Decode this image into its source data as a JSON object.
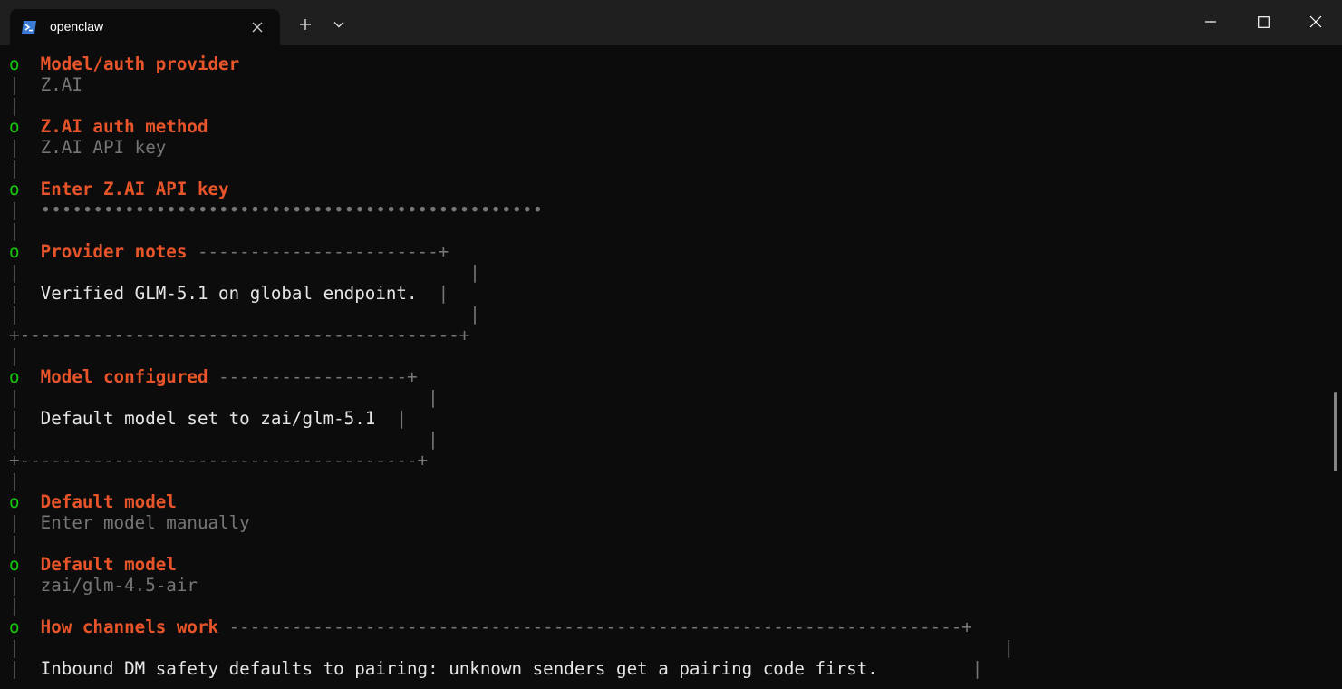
{
  "window": {
    "tab_title": "openclaw",
    "icons": {
      "tab": "powershell-icon",
      "close": "close-icon",
      "new_tab": "plus-icon",
      "dropdown": "chevron-down-icon",
      "minimize": "minimize-icon",
      "maximize": "maximize-icon",
      "window_close": "close-icon"
    }
  },
  "colors": {
    "background": "#0c0c0c",
    "titlebar": "#1f1f1f",
    "heading": "#e8542a",
    "bullet": "#16c60c",
    "dim": "#767676",
    "text": "#e6e6e6"
  },
  "terminal": {
    "glyphs": {
      "bullet": "o",
      "bar": "│",
      "corner": "+",
      "dash": "-",
      "pipe": "|"
    },
    "lines": [
      {
        "gutter": "o",
        "heading": "Model/auth provider"
      },
      {
        "gutter": "|",
        "value": "Z.AI"
      },
      {
        "gutter": "|"
      },
      {
        "gutter": "o",
        "heading": "Z.AI auth method"
      },
      {
        "gutter": "|",
        "value": "Z.AI API key"
      },
      {
        "gutter": "|"
      },
      {
        "gutter": "o",
        "heading": "Enter Z.AI API key"
      },
      {
        "gutter": "|",
        "value": "••••••••••••••••••••••••••••••••••••••••••••••••"
      },
      {
        "gutter": "|"
      },
      {
        "gutter": "o",
        "heading": "Provider notes",
        "rule": " -----------------------+"
      },
      {
        "gutter": "|",
        "value": "",
        "right": "                                         |"
      },
      {
        "gutter": "|",
        "text": "Verified GLM-5.1 on global endpoint.",
        "right": "  |"
      },
      {
        "gutter": "|",
        "value": "",
        "right": "                                         |"
      },
      {
        "gutter": "+",
        "rule": "------------------------------------------+"
      },
      {
        "gutter": "|"
      },
      {
        "gutter": "o",
        "heading": "Model configured",
        "rule": " ------------------+"
      },
      {
        "gutter": "|",
        "value": "",
        "right": "                                     |"
      },
      {
        "gutter": "|",
        "text": "Default model set to zai/glm-5.1",
        "right": "  |"
      },
      {
        "gutter": "|",
        "value": "",
        "right": "                                     |"
      },
      {
        "gutter": "+",
        "rule": "--------------------------------------+"
      },
      {
        "gutter": "|"
      },
      {
        "gutter": "o",
        "heading": "Default model"
      },
      {
        "gutter": "|",
        "value": "Enter model manually"
      },
      {
        "gutter": "|"
      },
      {
        "gutter": "o",
        "heading": "Default model"
      },
      {
        "gutter": "|",
        "value": "zai/glm-4.5-air"
      },
      {
        "gutter": "|"
      },
      {
        "gutter": "o",
        "heading": "How channels work",
        "rule": " ----------------------------------------------------------------------+"
      },
      {
        "gutter": "|",
        "value": "",
        "right": "                                                                                            |"
      },
      {
        "gutter": "|",
        "text": "Inbound DM safety defaults to pairing: unknown senders get a pairing code first.",
        "right": "         |"
      }
    ]
  }
}
